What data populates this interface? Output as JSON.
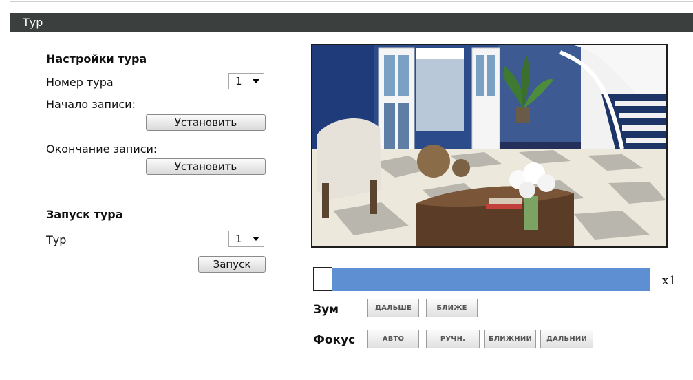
{
  "page": {
    "title": "Тур"
  },
  "tour_settings": {
    "heading": "Настройки тура",
    "tour_number_label": "Номер тура",
    "tour_number_value": "1",
    "record_start_label": "Начало записи:",
    "record_start_button": "Установить",
    "record_end_label": "Окончание записи:",
    "record_end_button": "Установить"
  },
  "tour_launch": {
    "heading": "Запуск тура",
    "tour_label": "Тур",
    "tour_value": "1",
    "launch_button": "Запуск"
  },
  "camera": {
    "zoom_level_text": "x1",
    "zoom_position_fraction": 0.0,
    "zoom_label": "Зум",
    "zoom_out_button": "ДАЛЬШЕ",
    "zoom_in_button": "БЛИЖЕ",
    "focus_label": "Фокус",
    "focus_auto_button": "АВТО",
    "focus_manual_button": "РУЧН.",
    "focus_near_button": "БЛИЖНИЙ",
    "focus_far_button": "ДАЛЬНИЙ"
  },
  "colors": {
    "title_bar": "#3b3f3e",
    "zoom_track": "#5e8fd2"
  }
}
